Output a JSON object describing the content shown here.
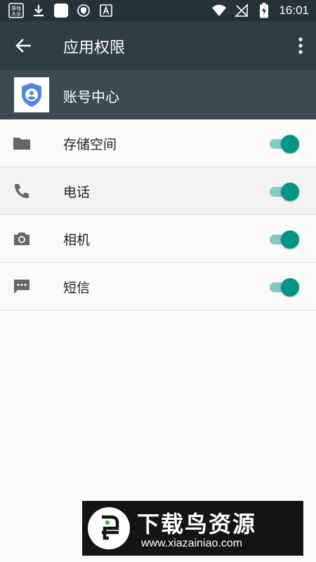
{
  "status_bar": {
    "time": "16:01",
    "left_icons": [
      "game-center-icon",
      "download-icon",
      "blank-app-icon",
      "shield-app-icon",
      "font-app-icon"
    ],
    "right_icons": [
      "wifi-icon",
      "no-signal-icon",
      "battery-charging-icon"
    ]
  },
  "app_bar": {
    "title": "应用权限",
    "back_icon": "arrow-back-icon",
    "menu_icon": "more-vert-icon",
    "background": "#2f3d44"
  },
  "app": {
    "name": "账号中心",
    "icon": "account-shield-icon",
    "icon_color": "#4a86e8"
  },
  "permissions": [
    {
      "label": "存储空间",
      "icon": "folder-icon",
      "enabled": true
    },
    {
      "label": "电话",
      "icon": "phone-icon",
      "enabled": true
    },
    {
      "label": "相机",
      "icon": "camera-icon",
      "enabled": true
    },
    {
      "label": "短信",
      "icon": "sms-icon",
      "enabled": true
    }
  ],
  "colors": {
    "toggle_on": "#009688",
    "toggle_track": "#80cbc4",
    "header_background": "#3c4b52"
  },
  "watermark": {
    "title": "下载鸟资源",
    "url": "www.xiazainiao.com",
    "logo": "bird-logo-icon"
  }
}
